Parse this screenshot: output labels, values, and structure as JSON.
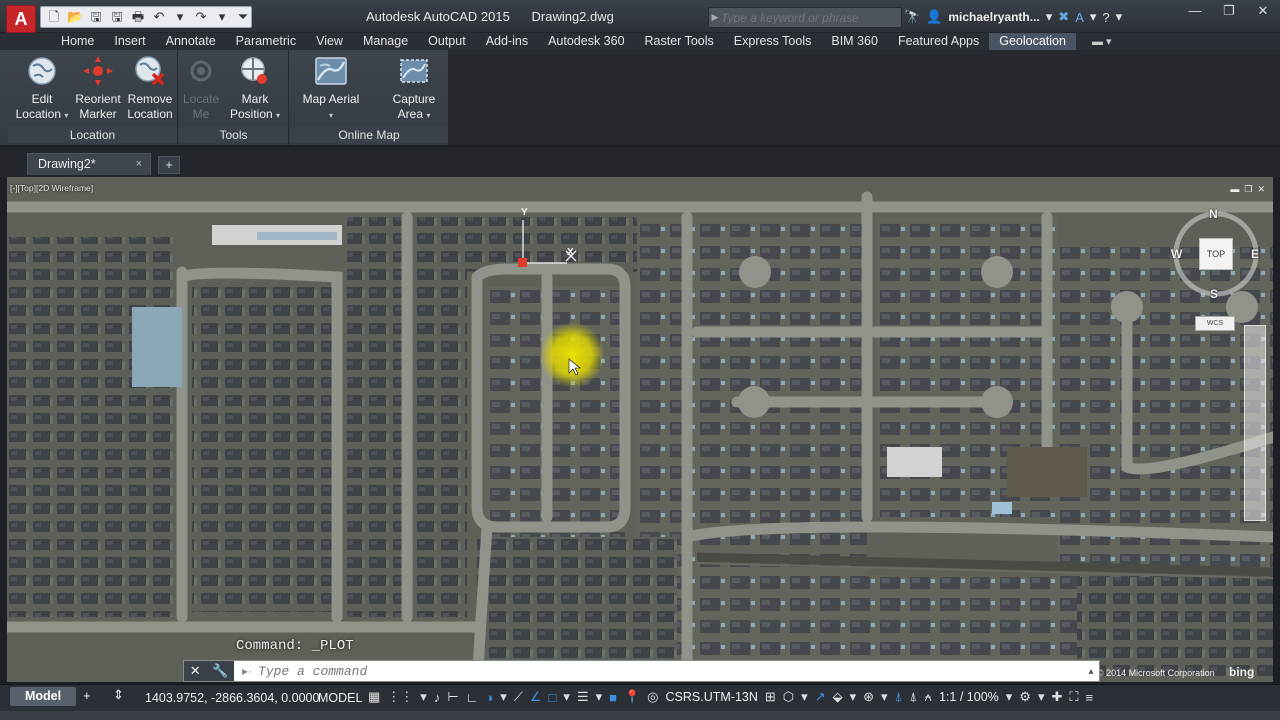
{
  "titlebar": {
    "app_name": "Autodesk AutoCAD 2015",
    "document_name": "Drawing2.dwg",
    "search_placeholder": "Type a keyword or phrase",
    "user_name": "michaelryanth..."
  },
  "ribbon_tabs": [
    "Home",
    "Insert",
    "Annotate",
    "Parametric",
    "View",
    "Manage",
    "Output",
    "Add-ins",
    "Autodesk 360",
    "Raster Tools",
    "Express Tools",
    "BIM 360",
    "Featured Apps",
    "Geolocation"
  ],
  "active_tab": "Geolocation",
  "ribbon": {
    "location_panel": {
      "label": "Location",
      "edit_location": [
        "Edit",
        "Location"
      ],
      "reorient_marker": [
        "Reorient",
        "Marker"
      ],
      "remove_location": [
        "Remove",
        "Location"
      ]
    },
    "tools_panel": {
      "label": "Tools",
      "locate_me": [
        "Locate",
        "Me"
      ],
      "mark_position": [
        "Mark",
        "Position"
      ]
    },
    "online_map_panel": {
      "label": "Online Map",
      "map_aerial": "Map Aerial",
      "capture_area": [
        "Capture",
        "Area"
      ]
    }
  },
  "file_tab": {
    "label": "Drawing2*",
    "close": "×",
    "new_tab": "+"
  },
  "viewport": {
    "label": "[-][Top][2D Wireframe]",
    "viewcube": {
      "top_label": "TOP",
      "north": "N",
      "south": "S",
      "east": "E",
      "west": "W",
      "wcs_label": "WCS"
    },
    "ucs_y_label": "Y",
    "ucs_x_label": "X",
    "command_history": "Command: _PLOT",
    "copyright": "© 2014 Microsoft Corporation",
    "bing_logo": "bing"
  },
  "command_line": {
    "placeholder": "Type a command"
  },
  "statusbar": {
    "layout_tab": "Model",
    "coordinates": "1403.9752, -2866.3604, 0.0000",
    "model_label": "MODEL",
    "coordinate_system": "CSRS.UTM-13N",
    "annotation_scale": "1:1 / 100%"
  },
  "colors": {
    "ribbon_bg": "#3d444c",
    "active_tab": "#4a5563",
    "autocad_red": "#c8252b",
    "marker_highlight": "#f2e600",
    "aerial_base": "#5d6157"
  }
}
